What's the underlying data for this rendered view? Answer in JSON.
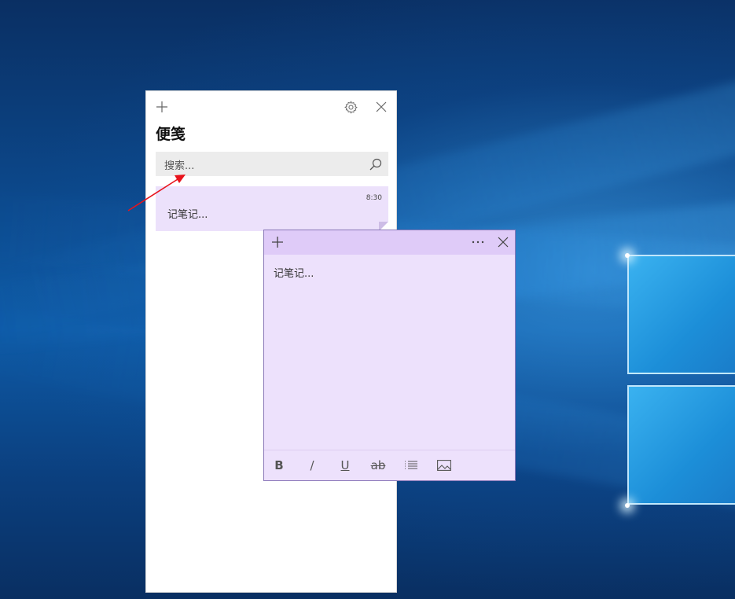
{
  "list_window": {
    "title": "便笺",
    "new_icon": "plus-icon",
    "settings_icon": "gear-icon",
    "close_icon": "close-icon",
    "search": {
      "placeholder": "搜索...",
      "icon": "search-icon"
    },
    "notes": [
      {
        "time": "8:30",
        "preview": "记笔记..."
      }
    ]
  },
  "note_window": {
    "new_icon": "plus-icon",
    "menu_icon": "more-icon",
    "close_icon": "close-icon",
    "body_placeholder": "记笔记...",
    "color": "#ede1fc",
    "toolbar": {
      "bold": "B",
      "italic": "/",
      "underline": "U",
      "strikethrough": "ab",
      "list_icon": "bullet-list-icon",
      "image_icon": "image-icon"
    }
  },
  "annotation": {
    "color": "#e8131b"
  }
}
